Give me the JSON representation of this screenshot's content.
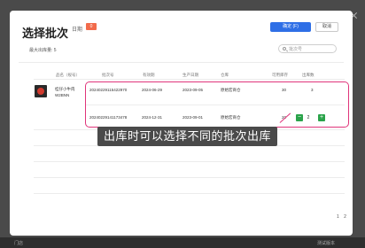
{
  "header": {
    "title": "选择批次",
    "today_label": "日期",
    "today_badge": "0",
    "confirm_label": "确定 (F)",
    "cancel_label": "取消"
  },
  "toolbar": {
    "max_out_label": "最大出库量: 5",
    "search_placeholder": "批次号"
  },
  "table": {
    "headers": [
      "品名（规号）",
      "批次号",
      "有效期",
      "生产日期",
      "仓库",
      "可用库存",
      "出库数"
    ],
    "product": {
      "name": "桂仔小牛肉",
      "code": "W2BNN"
    },
    "rows": [
      {
        "batch": "20240229115422970",
        "expiry": "2024-06-29",
        "production": "2023-09-05",
        "warehouse": "原始宏商仓",
        "stock": "30",
        "out_qty": "3"
      },
      {
        "batch": "20240229141173478",
        "expiry": "2024-12-31",
        "production": "2023-09-01",
        "warehouse": "原始宏商仓",
        "stock": "20",
        "out_qty": "2"
      }
    ]
  },
  "annotation": {
    "caption": "出库时可以选择不同的批次出库",
    "highlight_color": "#e0347a"
  },
  "pager": {
    "page": "1",
    "total": "2"
  },
  "status_bar": {
    "left": "门店",
    "right": "测试版本"
  },
  "colors": {
    "primary": "#2f6fe6",
    "badge": "#f26b4b",
    "stepper": "#2aa34a"
  }
}
